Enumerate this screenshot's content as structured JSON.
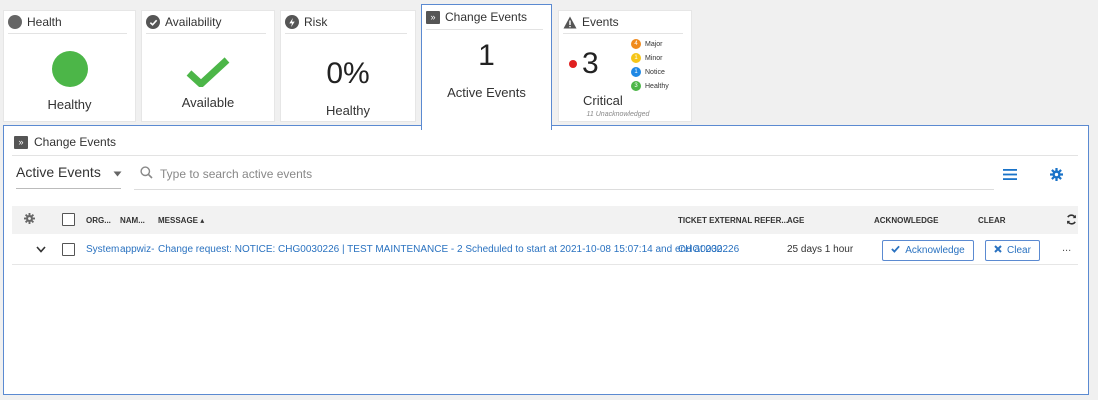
{
  "cards": {
    "health": {
      "title": "Health",
      "status": "Healthy",
      "color": "#4cb648"
    },
    "availability": {
      "title": "Availability",
      "status": "Available",
      "color": "#4cb648"
    },
    "risk": {
      "title": "Risk",
      "value": "0%",
      "status": "Healthy"
    },
    "change_events": {
      "title": "Change Events",
      "value": "1",
      "status": "Active Events"
    },
    "events": {
      "title": "Events",
      "count": "3",
      "label": "Critical",
      "unack": "11 Unacknowledged",
      "critical_color": "#e02020",
      "legend": [
        {
          "count": "4",
          "label": "Major",
          "color": "#f08a1c"
        },
        {
          "count": "1",
          "label": "Minor",
          "color": "#f5c518"
        },
        {
          "count": "1",
          "label": "Notice",
          "color": "#1e88e5"
        },
        {
          "count": "3",
          "label": "Healthy",
          "color": "#4cb648"
        }
      ]
    }
  },
  "panel": {
    "title": "Change Events",
    "view_label": "Active Events",
    "search_placeholder": "Type to search active events"
  },
  "table": {
    "columns": {
      "org": "ORG...",
      "name": "NAM...",
      "message": "MESSAGE ▴",
      "ticket": "TICKET EXTERNAL REFER...",
      "age": "AGE",
      "ack": "ACKNOWLEDGE",
      "clear": "CLEAR"
    },
    "rows": [
      {
        "org": "System",
        "name": "appwiz-",
        "message": "Change request: NOTICE: CHG0030226 | TEST MAINTENANCE - 2 Scheduled to start at 2021-10-08 15:07:14 and end at 202...",
        "ticket": "CHG0030226",
        "age": "25 days 1 hour",
        "ack_label": "Acknowledge",
        "clear_label": "Clear",
        "more": "..."
      }
    ]
  },
  "colors": {
    "accent": "#1a73c8",
    "border_active": "#5b8ad1"
  }
}
